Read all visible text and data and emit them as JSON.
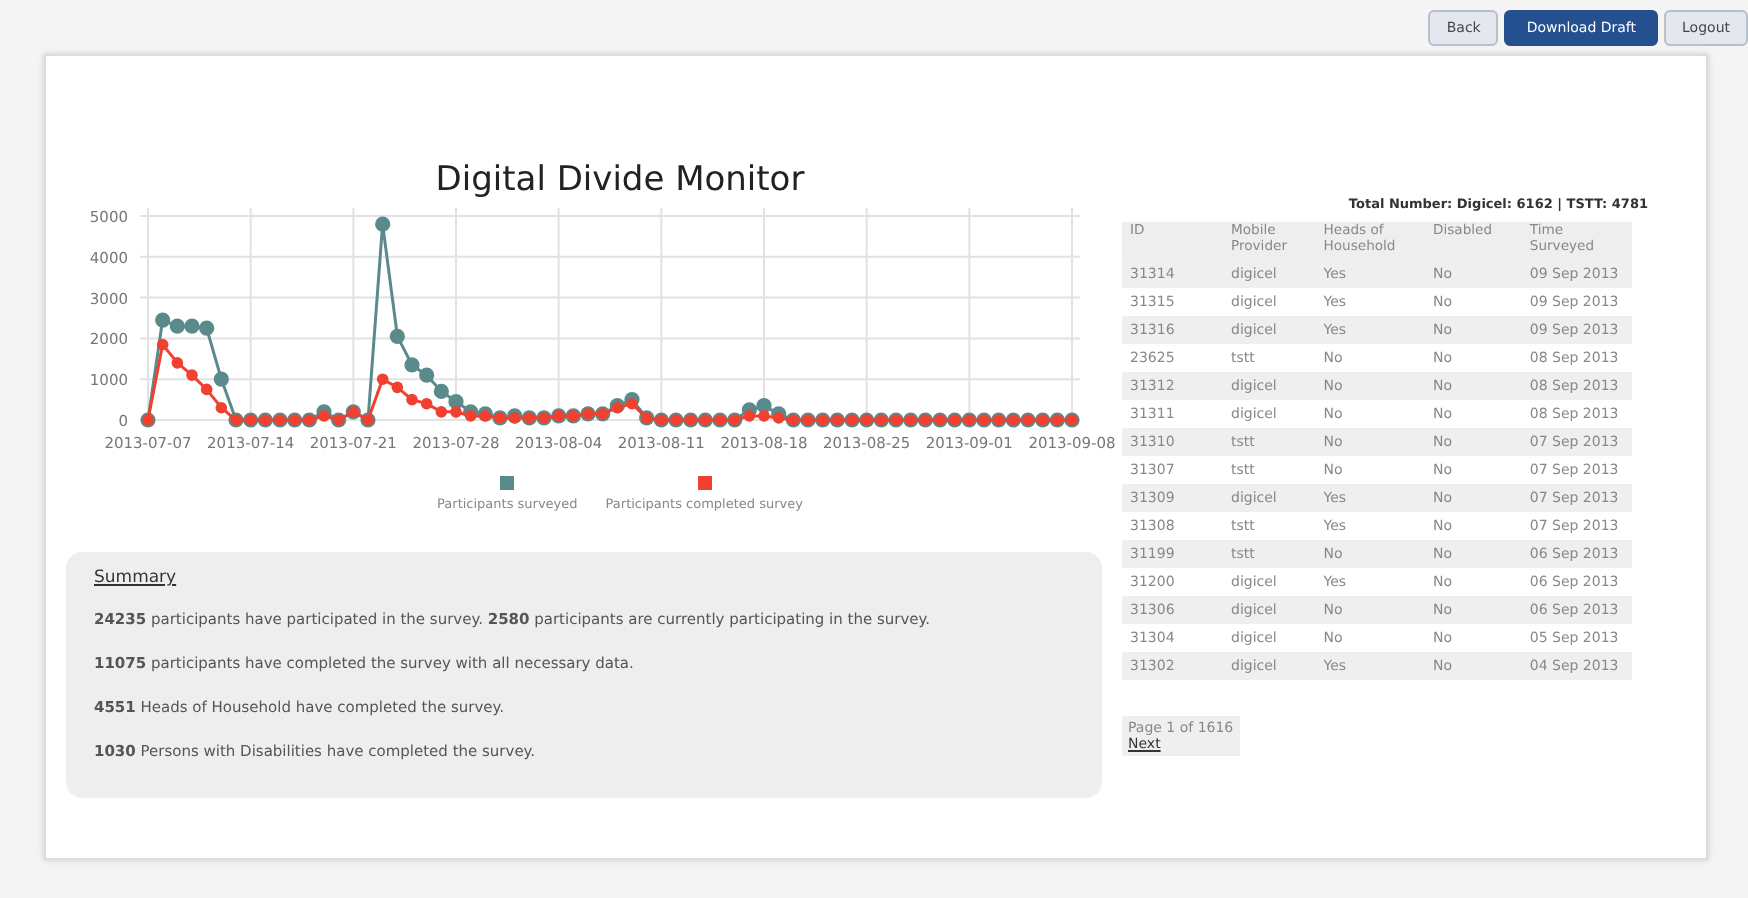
{
  "nav_buttons": [
    {
      "label": "Back",
      "selected": false
    },
    {
      "label": "Download Draft",
      "selected": true
    },
    {
      "label": "Logout",
      "selected": false
    }
  ],
  "chart": {
    "chart_data": {
      "type": "line",
      "title": "Digital Divide Monitor",
      "grid": true,
      "legend": true,
      "xlim": [
        "2013-07-07",
        "2013-09-08"
      ],
      "x": [
        "2013-07-07",
        "2013-07-08",
        "2013-07-09",
        "2013-07-10",
        "2013-07-11",
        "2013-07-12",
        "2013-07-13",
        "2013-07-14",
        "2013-07-15",
        "2013-07-16",
        "2013-07-17",
        "2013-07-18",
        "2013-07-19",
        "2013-07-20",
        "2013-07-21",
        "2013-07-22",
        "2013-07-23",
        "2013-07-24",
        "2013-07-25",
        "2013-07-26",
        "2013-07-27",
        "2013-07-28",
        "2013-07-29",
        "2013-07-30",
        "2013-07-31",
        "2013-08-01",
        "2013-08-02",
        "2013-08-03",
        "2013-08-04",
        "2013-08-05",
        "2013-08-06",
        "2013-08-07",
        "2013-08-08",
        "2013-08-09",
        "2013-08-10",
        "2013-08-11",
        "2013-08-12",
        "2013-08-13",
        "2013-08-14",
        "2013-08-15",
        "2013-08-16",
        "2013-08-17",
        "2013-08-18",
        "2013-08-19",
        "2013-08-20",
        "2013-08-21",
        "2013-08-22",
        "2013-08-23",
        "2013-08-24",
        "2013-08-25",
        "2013-08-26",
        "2013-08-27",
        "2013-08-28",
        "2013-08-29",
        "2013-08-30",
        "2013-08-31",
        "2013-09-01",
        "2013-09-02",
        "2013-09-03",
        "2013-09-04",
        "2013-09-05",
        "2013-09-06",
        "2013-09-07",
        "2013-09-08"
      ],
      "series": [
        {
          "name": "Participants surveyed",
          "color": "#5a8a8c",
          "marker": "circle",
          "values": [
            0,
            2450,
            2300,
            2300,
            2250,
            1000,
            0,
            0,
            0,
            0,
            0,
            0,
            200,
            0,
            200,
            0,
            4800,
            2050,
            1350,
            1100,
            700,
            450,
            200,
            150,
            50,
            100,
            50,
            50,
            100,
            100,
            150,
            150,
            350,
            500,
            50,
            0,
            0,
            0,
            0,
            0,
            0,
            250,
            350,
            150,
            0,
            0,
            0,
            0,
            0,
            0,
            0,
            0,
            0,
            0,
            0,
            0,
            0,
            0,
            0,
            0,
            0,
            0,
            0,
            0
          ]
        },
        {
          "name": "Participants completed survey",
          "color": "#f0402f",
          "marker": "circle",
          "values": [
            0,
            1850,
            1400,
            1100,
            750,
            300,
            0,
            0,
            0,
            0,
            0,
            0,
            100,
            0,
            200,
            0,
            1000,
            800,
            500,
            400,
            200,
            200,
            100,
            100,
            50,
            50,
            50,
            50,
            100,
            100,
            150,
            150,
            300,
            400,
            50,
            0,
            0,
            0,
            0,
            0,
            0,
            100,
            100,
            50,
            0,
            0,
            0,
            0,
            0,
            0,
            0,
            0,
            0,
            0,
            0,
            0,
            0,
            0,
            0,
            0,
            0,
            0,
            0,
            0
          ]
        }
      ],
      "ylim": [
        0,
        5000
      ],
      "yticks": [
        0,
        1000,
        2000,
        3000,
        4000,
        5000
      ],
      "xticks": [
        "2013-07-07",
        "2013-07-14",
        "2013-07-21",
        "2013-07-28",
        "2013-08-04",
        "2013-08-11",
        "2013-08-18",
        "2013-08-25",
        "2013-09-01",
        "2013-09-08"
      ]
    }
  },
  "summary": {
    "heading": "Summary",
    "lines": [
      "**24235** participants have participated in the survey. **2580** participants are currently participating in the survey.",
      "**11075** participants have completed the survey with all necessary data.",
      "**4551** Heads of Household have completed the survey.",
      "**1030** Persons with Disabilities have completed the survey."
    ]
  },
  "totals": "Total Number: Digicel: 6162 | TSTT: 4781",
  "table": {
    "columns": [
      "ID",
      "Mobile Provider",
      "Heads of Household",
      "Disabled",
      "Time Surveyed"
    ],
    "rows": [
      [
        "31314",
        "digicel",
        "Yes",
        "No",
        "09 Sep 2013"
      ],
      [
        "31315",
        "digicel",
        "Yes",
        "No",
        "09 Sep 2013"
      ],
      [
        "31316",
        "digicel",
        "Yes",
        "No",
        "09 Sep 2013"
      ],
      [
        "23625",
        "tstt",
        "No",
        "No",
        "08 Sep 2013"
      ],
      [
        "31312",
        "digicel",
        "No",
        "No",
        "08 Sep 2013"
      ],
      [
        "31311",
        "digicel",
        "No",
        "No",
        "08 Sep 2013"
      ],
      [
        "31310",
        "tstt",
        "No",
        "No",
        "07 Sep 2013"
      ],
      [
        "31307",
        "tstt",
        "No",
        "No",
        "07 Sep 2013"
      ],
      [
        "31309",
        "digicel",
        "Yes",
        "No",
        "07 Sep 2013"
      ],
      [
        "31308",
        "tstt",
        "Yes",
        "No",
        "07 Sep 2013"
      ],
      [
        "31199",
        "tstt",
        "No",
        "No",
        "06 Sep 2013"
      ],
      [
        "31200",
        "digicel",
        "Yes",
        "No",
        "06 Sep 2013"
      ],
      [
        "31306",
        "digicel",
        "No",
        "No",
        "06 Sep 2013"
      ],
      [
        "31304",
        "digicel",
        "No",
        "No",
        "05 Sep 2013"
      ],
      [
        "31302",
        "digicel",
        "Yes",
        "No",
        "04 Sep 2013"
      ]
    ]
  },
  "pagination": {
    "text": "Page 1 of 1616",
    "next": "Next"
  }
}
